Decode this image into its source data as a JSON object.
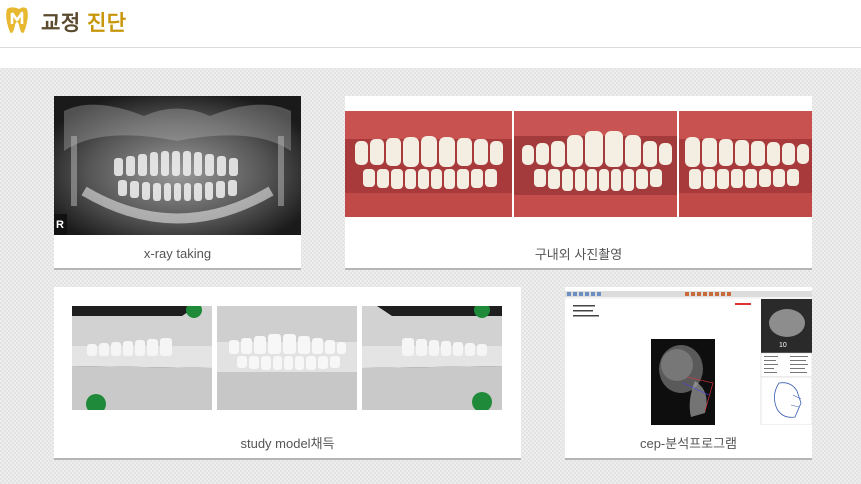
{
  "header": {
    "title_part1": "교정",
    "title_part2": "진단",
    "logo_icon": "tooth-m-logo-icon"
  },
  "cards": {
    "xray": {
      "caption": "x-ray taking",
      "badge": "R"
    },
    "intraoral": {
      "caption": "구내외 사진촬영"
    },
    "model": {
      "caption": "study model채득"
    },
    "cep": {
      "caption": "cep-분석프로그램"
    }
  },
  "colors": {
    "title_dark": "#5a4a2e",
    "title_gold": "#c8960a",
    "logo": "#e8b830",
    "gum": "#c8403f"
  }
}
